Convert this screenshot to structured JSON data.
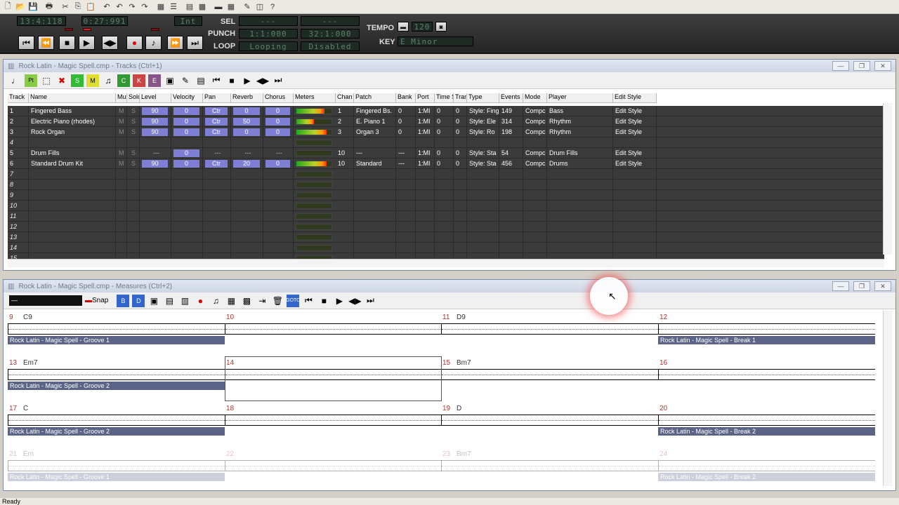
{
  "toolbar": {
    "icons": [
      "new-icon",
      "open-icon",
      "save-icon",
      "print-icon",
      "cut-icon",
      "copy-icon",
      "paste-icon",
      "undo-icon",
      "undo2-icon",
      "redo-icon",
      "redo2-icon",
      "chord-icon",
      "list-icon",
      "tracks-icon",
      "grid-icon",
      "song-icon",
      "table-icon",
      "edit-icon",
      "mixer-icon",
      "help-icon"
    ]
  },
  "transport": {
    "bar_beat": "13:4:118",
    "time": "0:27:991",
    "sync": "Int",
    "sel_label": "SEL",
    "sel_from": "---",
    "sel_to": "---",
    "punch_label": "PUNCH",
    "punch_from": "1:1:000",
    "punch_to": "32:1:000",
    "loop_label": "LOOP",
    "loop_mode": "Looping",
    "loop_status": "Disabled",
    "tempo_label": "TEMPO",
    "tempo": "120",
    "key_label": "KEY",
    "key": "E Minor"
  },
  "tracks_window": {
    "title": "Rock Latin - Magic Spell.cmp - Tracks (Ctrl+1)",
    "headers": [
      "Track",
      "Name",
      "Mut",
      "Solo",
      "Level",
      "Velocity",
      "Pan",
      "Reverb",
      "Chorus",
      "Meters",
      "Chan",
      "Patch",
      "Bank",
      "Port",
      "Time S",
      "Tran",
      "Type",
      "Events",
      "Mode",
      "Player",
      "Edit Style"
    ],
    "rows": [
      {
        "n": "1",
        "name": "Fingered Bass",
        "level": "90",
        "velocity": "0",
        "pan": "Ctr",
        "reverb": "0",
        "chorus": "0",
        "meter": 0.8,
        "chan": "1",
        "patch": "Fingered Bs.",
        "bank": "0",
        "port": "1:MI",
        "time": "0",
        "tran": "0",
        "type": "Style: Fing",
        "events": "149",
        "mode": "Compc",
        "player": "Bass",
        "edit": "Edit Style"
      },
      {
        "n": "2",
        "name": "Electric Piano (rhodes)",
        "level": "90",
        "velocity": "0",
        "pan": "Ctr",
        "reverb": "50",
        "chorus": "0",
        "meter": 0.5,
        "chan": "2",
        "patch": "E. Piano 1",
        "bank": "0",
        "port": "1:MI",
        "time": "0",
        "tran": "0",
        "type": "Style: Ele",
        "events": "314",
        "mode": "Compc",
        "player": "Rhythm",
        "edit": "Edit Style"
      },
      {
        "n": "3",
        "name": "Rock Organ",
        "level": "90",
        "velocity": "0",
        "pan": "Ctr",
        "reverb": "0",
        "chorus": "0",
        "meter": 0.85,
        "chan": "3",
        "patch": "Organ 3",
        "bank": "0",
        "port": "1:MI",
        "time": "0",
        "tran": "0",
        "type": "Style: Ro",
        "events": "198",
        "mode": "Compc",
        "player": "Rhythm",
        "edit": "Edit Style"
      },
      {
        "n": "4",
        "empty": true
      },
      {
        "n": "5",
        "name": "Drum Fills",
        "level": "---",
        "velocity": "0",
        "pan": "---",
        "reverb": "---",
        "chorus": "---",
        "meter": 0,
        "chan": "10",
        "patch": "---",
        "bank": "---",
        "port": "1:MI",
        "time": "0",
        "tran": "0",
        "type": "Style: Sta",
        "events": "54",
        "mode": "Compc",
        "player": "Drum Fills",
        "edit": "Edit Style",
        "dim": true
      },
      {
        "n": "6",
        "name": "Standard Drum Kit",
        "level": "90",
        "velocity": "0",
        "pan": "Ctr",
        "reverb": "20",
        "chorus": "0",
        "meter": 0.85,
        "chan": "10",
        "patch": "Standard",
        "bank": "---",
        "port": "1:MI",
        "time": "0",
        "tran": "0",
        "type": "Style: Sta",
        "events": "456",
        "mode": "Compc",
        "player": "Drums",
        "edit": "Edit Style"
      },
      {
        "n": "7",
        "empty": true
      },
      {
        "n": "8",
        "empty": true
      },
      {
        "n": "9",
        "empty": true
      },
      {
        "n": "10",
        "empty": true
      },
      {
        "n": "11",
        "empty": true
      },
      {
        "n": "12",
        "empty": true
      },
      {
        "n": "13",
        "empty": true
      },
      {
        "n": "14",
        "empty": true
      },
      {
        "n": "15",
        "empty": true
      }
    ],
    "mute": "M",
    "solo": "S"
  },
  "measures_window": {
    "title": "Rock Latin - Magic Spell.cmp - Measures (Ctrl+2)",
    "snap": "Snap",
    "rows": [
      {
        "measures": [
          {
            "n": "9",
            "chord": "C9"
          },
          {
            "n": "10",
            "chord": ""
          },
          {
            "n": "11",
            "chord": "D9"
          },
          {
            "n": "12",
            "chord": ""
          }
        ],
        "bands": [
          {
            "label": "Rock Latin - Magic Spell - Groove 1",
            "slot": 0
          },
          {
            "label": "Rock Latin - Magic Spell - Break 1",
            "slot": 3
          }
        ]
      },
      {
        "measures": [
          {
            "n": "13",
            "chord": "Em7"
          },
          {
            "n": "14",
            "chord": ""
          },
          {
            "n": "15",
            "chord": "Bm7"
          },
          {
            "n": "16",
            "chord": ""
          }
        ],
        "bands": [
          {
            "label": "Rock Latin - Magic Spell - Groove 2",
            "slot": 0
          }
        ]
      },
      {
        "measures": [
          {
            "n": "17",
            "chord": "C"
          },
          {
            "n": "18",
            "chord": ""
          },
          {
            "n": "19",
            "chord": "D"
          },
          {
            "n": "20",
            "chord": ""
          }
        ],
        "bands": [
          {
            "label": "Rock Latin - Magic Spell - Groove 2",
            "slot": 0
          },
          {
            "label": "Rock Latin - Magic Spell - Break 2",
            "slot": 3
          }
        ]
      },
      {
        "measures": [
          {
            "n": "21",
            "chord": "Em"
          },
          {
            "n": "22",
            "chord": ""
          },
          {
            "n": "23",
            "chord": "Bm7"
          },
          {
            "n": "24",
            "chord": ""
          }
        ],
        "bands": [
          {
            "label": "Rock Latin - Magic Spell - Groove 1",
            "slot": 0
          },
          {
            "label": "Rock Latin - Magic Spell - Break 2",
            "slot": 3
          }
        ],
        "faded": true
      }
    ]
  },
  "status": "Ready"
}
